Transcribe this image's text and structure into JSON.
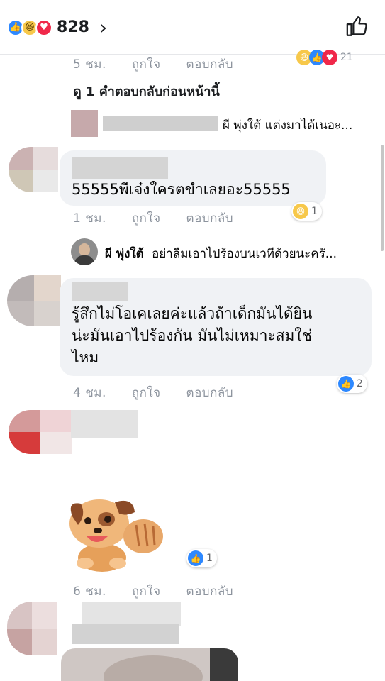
{
  "header": {
    "reaction_count": "828"
  },
  "comment_top": {
    "time": "5 ชม.",
    "like": "ถูกใจ",
    "reply": "ตอบกลับ",
    "reaction_count": "21"
  },
  "view_replies": "ดู 1 คำตอบกลับก่อนหน้านี้",
  "reply1": {
    "snippet": "ผี พุ่งใต้  แต่งมาได้เนอะ..."
  },
  "comment1": {
    "text": "55555พีเจ๋งใครตขำเลยอะ55555",
    "time": "1 ชม.",
    "like": "ถูกใจ",
    "reply": "ตอบกลับ",
    "reaction_count": "1"
  },
  "reply2": {
    "name": "ผี พุ่งใต้",
    "text": "อย่าลืมเอาไปร้องบนเวทีด้วยนะครั..."
  },
  "comment2": {
    "lines": [
      "รู้สึกไม่โอเคเลยค่ะแล้วถ้าเด็กมันได้ยิน",
      "น่ะมันเอาไปร้องกัน มันไม่เหมาะสมใช่",
      "ไหม"
    ],
    "time": "4 ชม.",
    "like": "ถูกใจ",
    "reply": "ตอบกลับ",
    "reaction_count": "2"
  },
  "comment3": {
    "time": "6 ชม.",
    "like": "ถูกใจ",
    "reply": "ตอบกลับ",
    "reaction_count": "1"
  },
  "colors": {
    "like": "#2d88ff",
    "haha": "#f7c84a",
    "love": "#f0284a",
    "meta": "#8d949e"
  },
  "icons": [
    "like-reaction-icon",
    "haha-reaction-icon",
    "love-reaction-icon",
    "chevron-right-icon",
    "thumbs-up-outline-icon",
    "dog-sticker"
  ]
}
